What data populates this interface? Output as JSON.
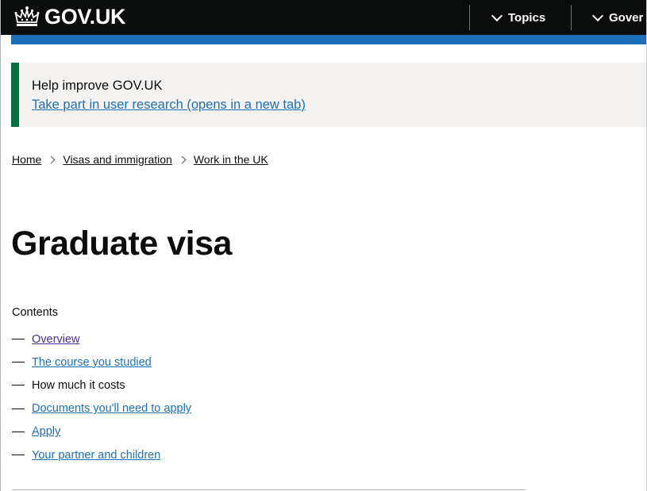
{
  "header": {
    "logo_text": "GOV.UK",
    "nav": [
      {
        "label": "Topics"
      },
      {
        "label": "Gover"
      }
    ],
    "colors": {
      "background": "#0b0c0c",
      "accent_bar": "#1d70b8"
    }
  },
  "banner": {
    "title": "Help improve GOV.UK",
    "link_text": "Take part in user research (opens in a new tab)",
    "accent_color": "#00703c"
  },
  "breadcrumb": {
    "items": [
      {
        "label": "Home"
      },
      {
        "label": "Visas and immigration"
      },
      {
        "label": "Work in the UK"
      }
    ]
  },
  "page": {
    "title": "Graduate visa"
  },
  "contents": {
    "heading": "Contents",
    "items": [
      {
        "label": "Overview",
        "state": "visited-link"
      },
      {
        "label": "The course you studied",
        "state": "link"
      },
      {
        "label": "How much it costs",
        "state": "current"
      },
      {
        "label": "Documents you'll need to apply",
        "state": "link"
      },
      {
        "label": "Apply",
        "state": "link"
      },
      {
        "label": "Your partner and children",
        "state": "link"
      }
    ]
  }
}
